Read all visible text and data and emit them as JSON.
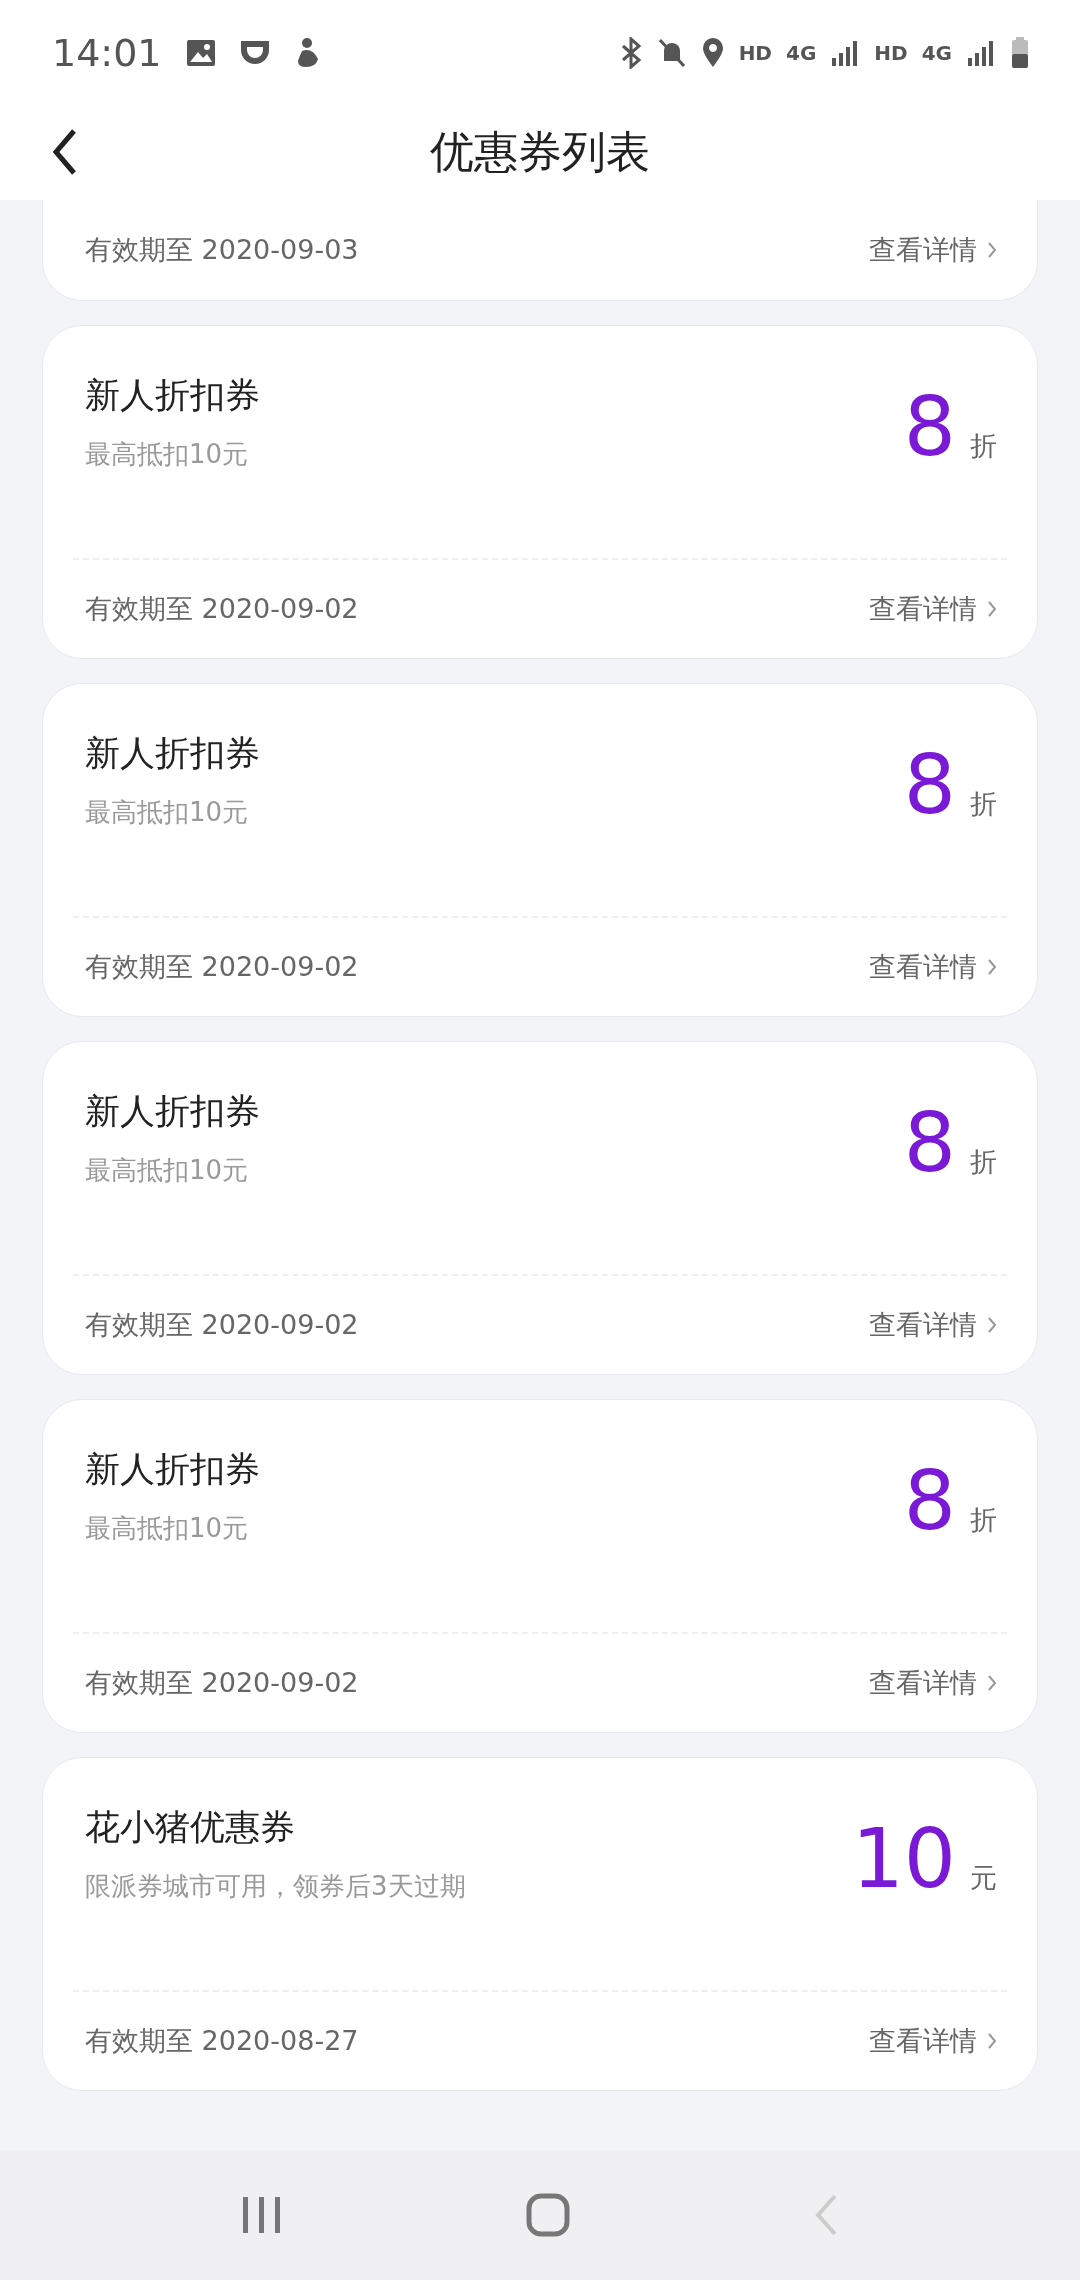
{
  "status_bar": {
    "time": "14:01",
    "texts": [
      "HD",
      "4G",
      "HD",
      "4G"
    ]
  },
  "header": {
    "title": "优惠券列表"
  },
  "coupons": [
    {
      "kind": "partial",
      "expiry": "有效期至 2020-09-03",
      "detail": "查看详情"
    },
    {
      "kind": "full",
      "title": "新人折扣券",
      "subtitle": "最高抵扣10元",
      "value": "8",
      "unit": "折",
      "expiry": "有效期至 2020-09-02",
      "detail": "查看详情"
    },
    {
      "kind": "full",
      "title": "新人折扣券",
      "subtitle": "最高抵扣10元",
      "value": "8",
      "unit": "折",
      "expiry": "有效期至 2020-09-02",
      "detail": "查看详情"
    },
    {
      "kind": "full",
      "title": "新人折扣券",
      "subtitle": "最高抵扣10元",
      "value": "8",
      "unit": "折",
      "expiry": "有效期至 2020-09-02",
      "detail": "查看详情"
    },
    {
      "kind": "full",
      "title": "新人折扣券",
      "subtitle": "最高抵扣10元",
      "value": "8",
      "unit": "折",
      "expiry": "有效期至 2020-09-02",
      "detail": "查看详情"
    },
    {
      "kind": "full",
      "title": "花小猪优惠券",
      "subtitle": "限派券城市可用，领券后3天过期",
      "value": "10",
      "unit": "元",
      "expiry": "有效期至 2020-08-27",
      "detail": "查看详情"
    }
  ]
}
